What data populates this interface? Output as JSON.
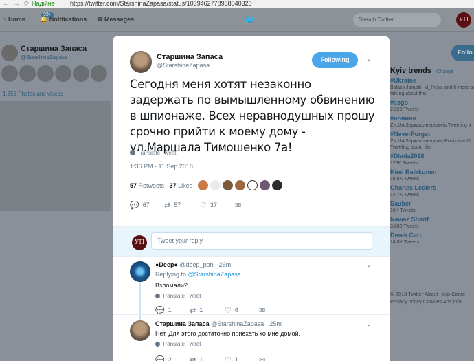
{
  "browser": {
    "secure_label": "Надійне",
    "url": "https://twitter.com/StarshinaZapasa/status/1039462778938040320"
  },
  "topnav": {
    "home": "Home",
    "notifications": "Notifications",
    "notifications_badge": "99+",
    "messages": "Messages",
    "search_placeholder": "Search Twitter",
    "me_avatar_text": "УП"
  },
  "background_profile": {
    "name": "Старшина Запаса",
    "handle": "@StarshinaZapasa",
    "photos_label": "1,656 Photos and videos",
    "follow_label": "Follo"
  },
  "trends": {
    "title": "Kyiv trends",
    "change_label": "· Change",
    "items": [
      {
        "tag": "#Ukraine",
        "sub": "Balazs Jarabik, M_Posp, and 6 more ar"
      },
      {
        "tag": "",
        "sub": "talking about this"
      },
      {
        "tag": "#csgo",
        "sub": "2,928 Tweets"
      },
      {
        "tag": "#новини",
        "sub": "ZN.UA Зеркало недели is Tweeting a"
      },
      {
        "tag": "#NeverForget",
        "sub": "ZN.UA Зеркало недели, Rostyslav Ol"
      },
      {
        "tag": "",
        "sub": "Tweeting about this"
      },
      {
        "tag": "#Diada2018",
        "sub": "126K Tweets"
      },
      {
        "tag": "Kimi Raikkonen",
        "sub": "18.8K Tweets"
      },
      {
        "tag": "Charles Leclerc",
        "sub": "14.7K Tweets"
      },
      {
        "tag": "Sauber",
        "sub": "16K Tweets"
      },
      {
        "tag": "Nawaz Sharif",
        "sub": "3,800 Tweets"
      },
      {
        "tag": "Derek Carr",
        "sub": "14.8K Tweets"
      }
    ],
    "footer_line1": "© 2018 Twitter   About   Help Cente",
    "footer_line2": "Privacy policy   Cookies   Ads info"
  },
  "tweet": {
    "author_name": "Старшина Запаса",
    "author_handle": "@StarshinaZapasa",
    "following_label": "Following",
    "text": "Сегодня меня хотят незаконно задержать по вымышленному обвинению в шпионаже. Всех неравнодушных прошу срочно прийти к моему дому - ул.Маршала Тимошенко 7а!",
    "translate_label": "Translate Tweet",
    "timestamp": "1:36 PM - 11 Sep 2018",
    "retweets_count": "57",
    "retweets_label": "Retweets",
    "likes_count": "37",
    "likes_label": "Likes",
    "reply_count": "67",
    "retweet_count": "57",
    "like_count": "37"
  },
  "reply_box": {
    "avatar_text": "УП",
    "placeholder": "Tweet your reply"
  },
  "replies": [
    {
      "name": "●Deep●",
      "handle": "@deep_poh",
      "time": "· 26m",
      "replying_to_label": "Replying to",
      "replying_to_handle": "@StarshinaZapasa",
      "text": "Взломали?",
      "translate_label": "Translate Tweet",
      "reply_count": "1",
      "retweet_count": "1",
      "like_count": "6"
    },
    {
      "name": "Старшина Запаса",
      "handle": "@StarshinaZapasa",
      "time": "· 25m",
      "text": "Нет. Для этого достаточно приехать ко мне домой.",
      "translate_label": "Translate Tweet",
      "reply_count": "2",
      "retweet_count": "1",
      "like_count": "1"
    }
  ],
  "colors": {
    "accent": "#1da1f2",
    "following_button": "#4aa6e8",
    "overlay_background": "#8a9099"
  }
}
